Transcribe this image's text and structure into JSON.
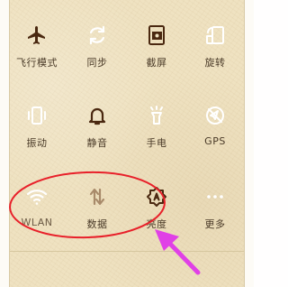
{
  "quick_settings": {
    "row1": [
      {
        "label": "飞行模式",
        "icon": "airplane-icon"
      },
      {
        "label": "同步",
        "icon": "sync-icon"
      },
      {
        "label": "截屏",
        "icon": "screenshot-icon"
      },
      {
        "label": "旋转",
        "icon": "rotate-icon"
      }
    ],
    "row2": [
      {
        "label": "振动",
        "icon": "vibrate-icon"
      },
      {
        "label": "静音",
        "icon": "bell-icon"
      },
      {
        "label": "手电",
        "icon": "flashlight-icon"
      },
      {
        "label": "GPS",
        "icon": "gps-icon"
      }
    ],
    "row3": [
      {
        "label": "WLAN",
        "icon": "wifi-icon"
      },
      {
        "label": "数据",
        "icon": "mobile-data-icon"
      },
      {
        "label": "亮度",
        "icon": "brightness-icon"
      },
      {
        "label": "更多",
        "icon": "more-icon"
      }
    ]
  },
  "annotation": {
    "circle_color": "#e8202a",
    "arrow_color": "#e040e6"
  },
  "colors": {
    "icon_dark": "#4a2810",
    "icon_light": "#ffffff",
    "icon_muted": "#a88a6a"
  }
}
